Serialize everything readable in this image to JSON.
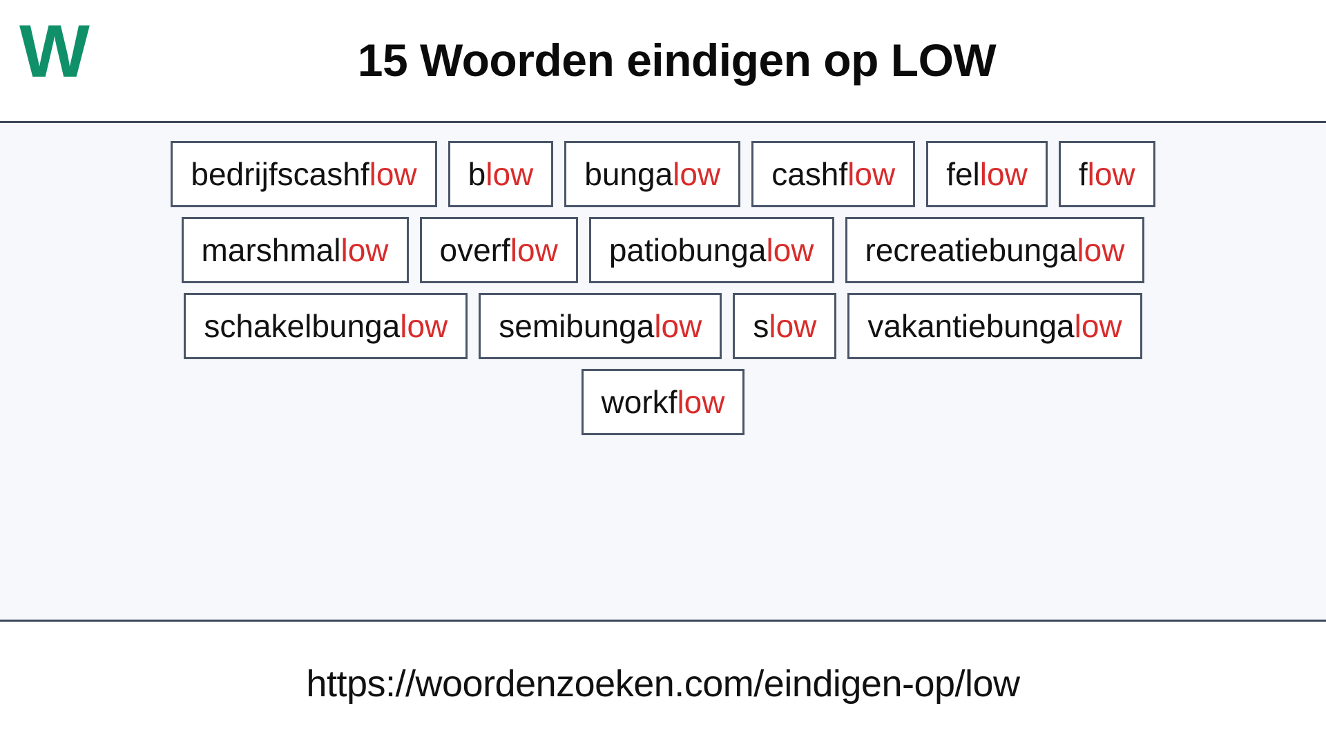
{
  "header": {
    "logo_text": "W",
    "logo_color": "#0f9068",
    "title": "15 Woorden eindigen op LOW"
  },
  "colors": {
    "suffix_highlight": "#d92b2b",
    "box_border": "#4a5568",
    "divider": "#3d4759",
    "page_background": "#f6f8fb",
    "box_background": "#ffffff",
    "text": "#111111"
  },
  "main": {
    "word_count": 15,
    "suffix": "low",
    "rows": [
      {
        "words": [
          {
            "prefix": "bedrijfscashf",
            "suffix": "low",
            "full": "bedrijfscashflow"
          },
          {
            "prefix": "b",
            "suffix": "low",
            "full": "blow"
          },
          {
            "prefix": "bunga",
            "suffix": "low",
            "full": "bungalow"
          },
          {
            "prefix": "cashf",
            "suffix": "low",
            "full": "cashflow"
          },
          {
            "prefix": "fel",
            "suffix": "low",
            "full": "fellow"
          },
          {
            "prefix": "f",
            "suffix": "low",
            "full": "flow"
          }
        ]
      },
      {
        "words": [
          {
            "prefix": "marshmal",
            "suffix": "low",
            "full": "marshmallow"
          },
          {
            "prefix": "overf",
            "suffix": "low",
            "full": "overflow"
          },
          {
            "prefix": "patiobunga",
            "suffix": "low",
            "full": "patiobungalow"
          },
          {
            "prefix": "recreatiebunga",
            "suffix": "low",
            "full": "recreatiebungalow"
          }
        ]
      },
      {
        "words": [
          {
            "prefix": "schakelbunga",
            "suffix": "low",
            "full": "schakelbungalow"
          },
          {
            "prefix": "semibunga",
            "suffix": "low",
            "full": "semibungalow"
          },
          {
            "prefix": "s",
            "suffix": "low",
            "full": "slow"
          },
          {
            "prefix": "vakantiebunga",
            "suffix": "low",
            "full": "vakantiebungalow"
          }
        ]
      },
      {
        "words": [
          {
            "prefix": "workf",
            "suffix": "low",
            "full": "workflow"
          }
        ]
      }
    ]
  },
  "footer": {
    "url": "https://woordenzoeken.com/eindigen-op/low"
  }
}
